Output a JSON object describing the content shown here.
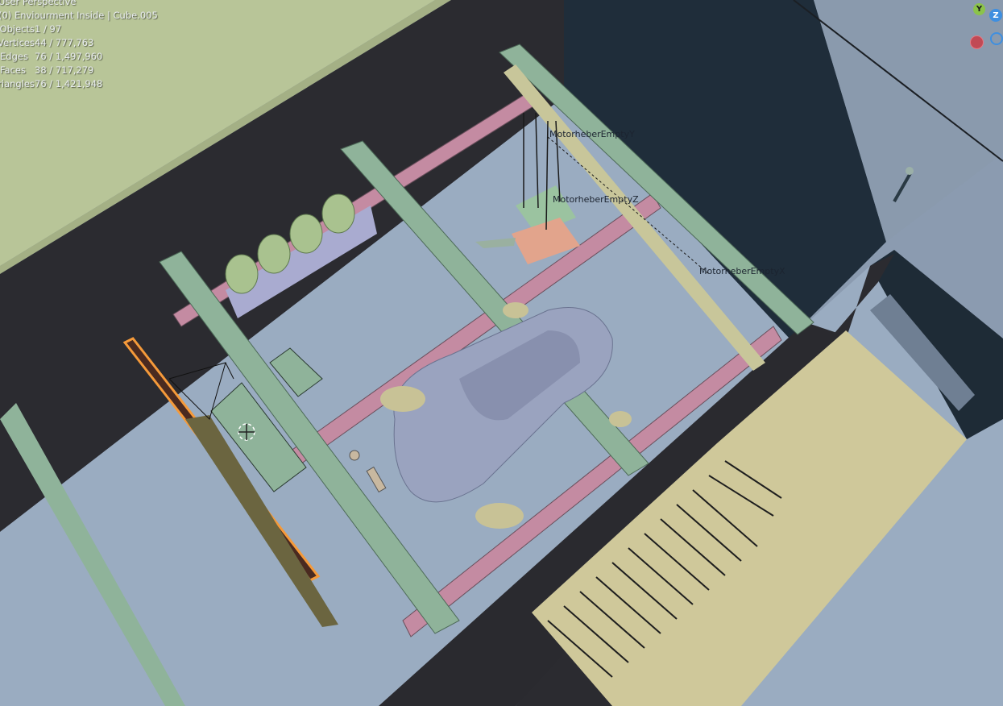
{
  "viewport": {
    "header_line1": "User Perspective",
    "header_line2": "(0) Enviourment Inside | Cube.005",
    "stats": [
      {
        "label": "Objects",
        "value": "1 / 97"
      },
      {
        "label": "Vertices",
        "value": "44 / 777,763"
      },
      {
        "label": "Edges",
        "value": "76 / 1,497,960"
      },
      {
        "label": "Faces",
        "value": "38 / 717,279"
      },
      {
        "label": "Triangles",
        "value": "76 / 1,421,948"
      }
    ]
  },
  "scene_labels": {
    "empty_y": "MotorheberEmptyY",
    "empty_z": "MotorheberEmptyZ",
    "empty_x": "MotorheberEmptyX"
  },
  "gizmo": {
    "y": "Y",
    "z": "Z",
    "x_neg": "",
    "y_neg": ""
  },
  "colors": {
    "background": "#7d8ea2",
    "floor": "#9fb0c2",
    "wall_dark": "#2a2a2e",
    "grass": "#b9c49a",
    "beam_green": "#8fb39a",
    "beam_pink": "#c48ba2",
    "selection": "#f59a3a"
  }
}
